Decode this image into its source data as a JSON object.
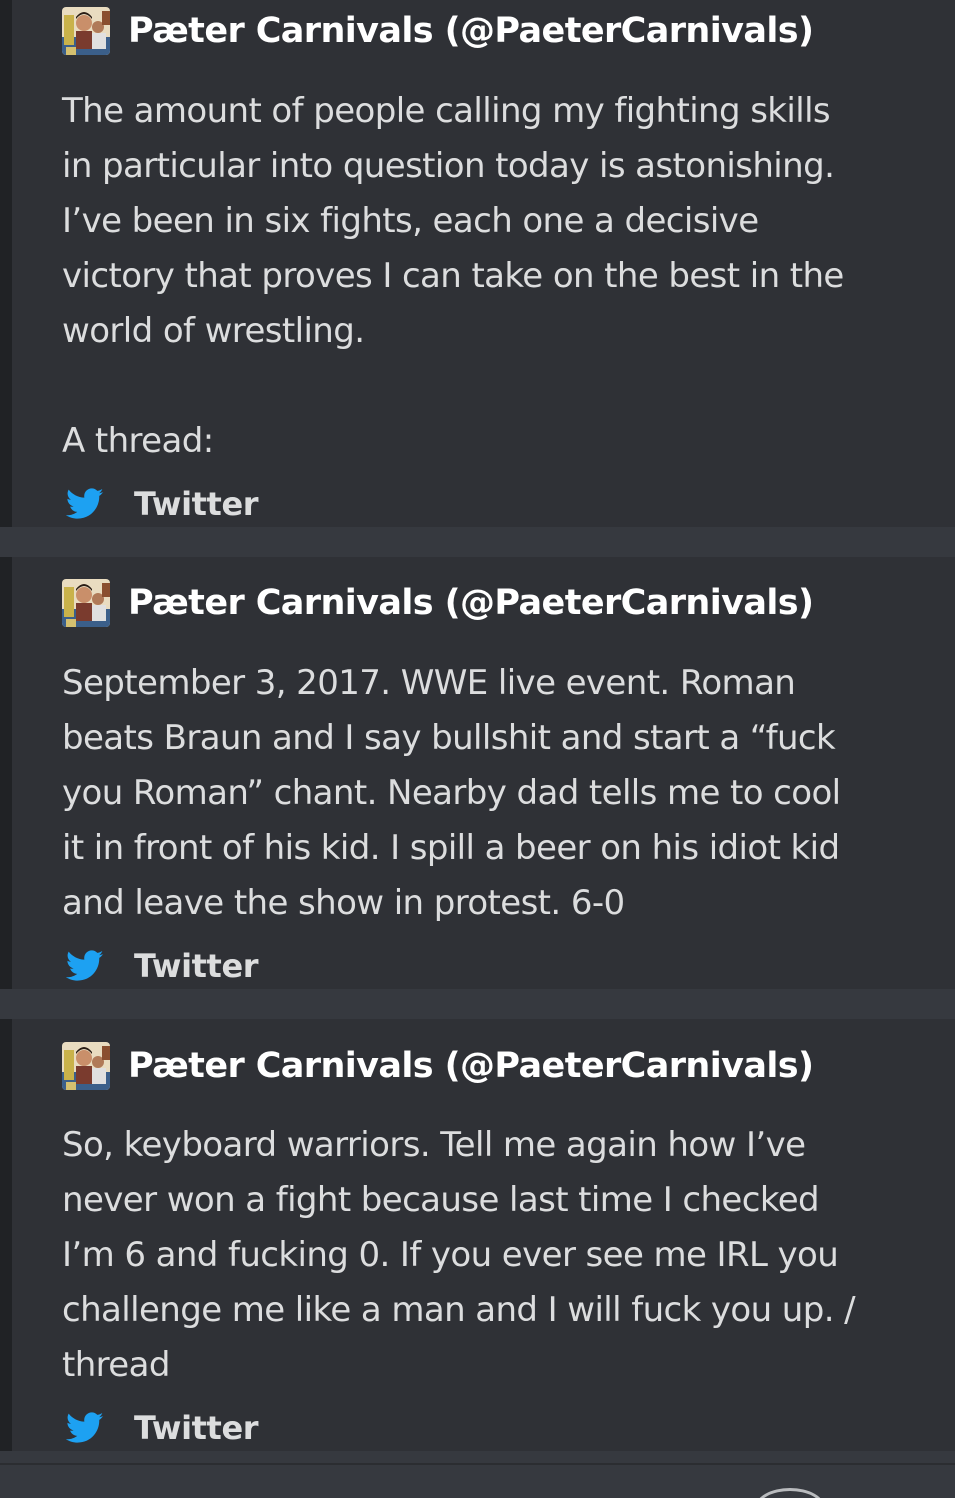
{
  "embeds": [
    {
      "author": "Pæter Carnivals (@PaeterCarnivals)",
      "avatar_icon": "user-avatar-icon",
      "description": "The amount of people calling my fighting skills\nin particular into question today is astonishing.\nI’ve been in six fights, each one a decisive\nvictory that proves I can take on the best in the\nworld of wrestling.\n\nA thread:",
      "footer": "Twitter",
      "footer_icon": "twitter-bird-icon"
    },
    {
      "author": "Pæter Carnivals (@PaeterCarnivals)",
      "avatar_icon": "user-avatar-icon",
      "description": "September 3, 2017. WWE live event. Roman\nbeats Braun and I say bullshit and start a “fuck\nyou Roman” chant. Nearby dad tells me to cool\nit in front of his kid. I spill a beer on his idiot kid\nand leave the show in protest. 6-0",
      "footer": "Twitter",
      "footer_icon": "twitter-bird-icon"
    },
    {
      "author": "Pæter Carnivals (@PaeterCarnivals)",
      "avatar_icon": "user-avatar-icon",
      "description": "So, keyboard warriors. Tell me again how I’ve\nnever won a fight because last time I checked\nI’m 6 and fucking 0. If you ever see me IRL you\nchallenge me like a man and I will fuck you up. /\nthread",
      "footer": "Twitter",
      "footer_icon": "twitter-bird-icon"
    }
  ],
  "colors": {
    "background": "#36393f",
    "embed_background": "#2f3136",
    "embed_bar": "#202225",
    "author_text": "#ffffff",
    "body_text": "#dcddde",
    "twitter_blue": "#1da1f2"
  }
}
